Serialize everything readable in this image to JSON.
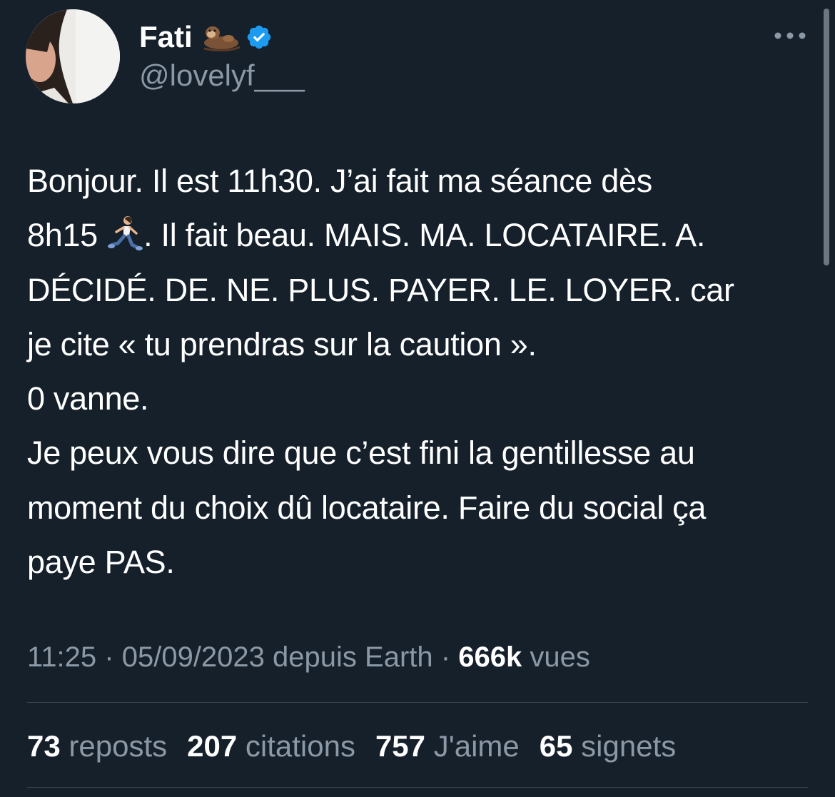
{
  "author": {
    "display_name": "Fati",
    "handle": "@lovelyf___",
    "verified": true,
    "name_emoji": "otter-emoji"
  },
  "tweet": {
    "lines": [
      "Bonjour. Il est 11h30. J’ai fait ma séance dès",
      "8h15 ",
      ". Il fait beau. MAIS. MA. LOCATAIRE. A.",
      "DÉCIDÉ. DE. NE. PLUS. PAYER. LE. LOYER. car",
      "je cite « tu prendras sur la caution ».",
      "0 vanne.",
      "Je peux vous dire que c’est fini la gentillesse au",
      "moment du choix dû locataire. Faire du social ça",
      "paye PAS."
    ],
    "inline_emoji": "running-woman-emoji"
  },
  "meta": {
    "time": "11:25",
    "separator": "·",
    "date": "05/09/2023",
    "source": "depuis Earth",
    "views_count": "666k",
    "views_label": "vues"
  },
  "stats": {
    "reposts_count": "73",
    "reposts_label": "reposts",
    "quotes_count": "207",
    "quotes_label": "citations",
    "likes_count": "757",
    "likes_label": "J'aime",
    "bookmarks_count": "65",
    "bookmarks_label": "signets"
  },
  "colors": {
    "background": "#15202b",
    "text": "#ffffff",
    "secondary_text": "#8b98a5",
    "divider": "#38444d",
    "verified": "#1d9bf0"
  }
}
